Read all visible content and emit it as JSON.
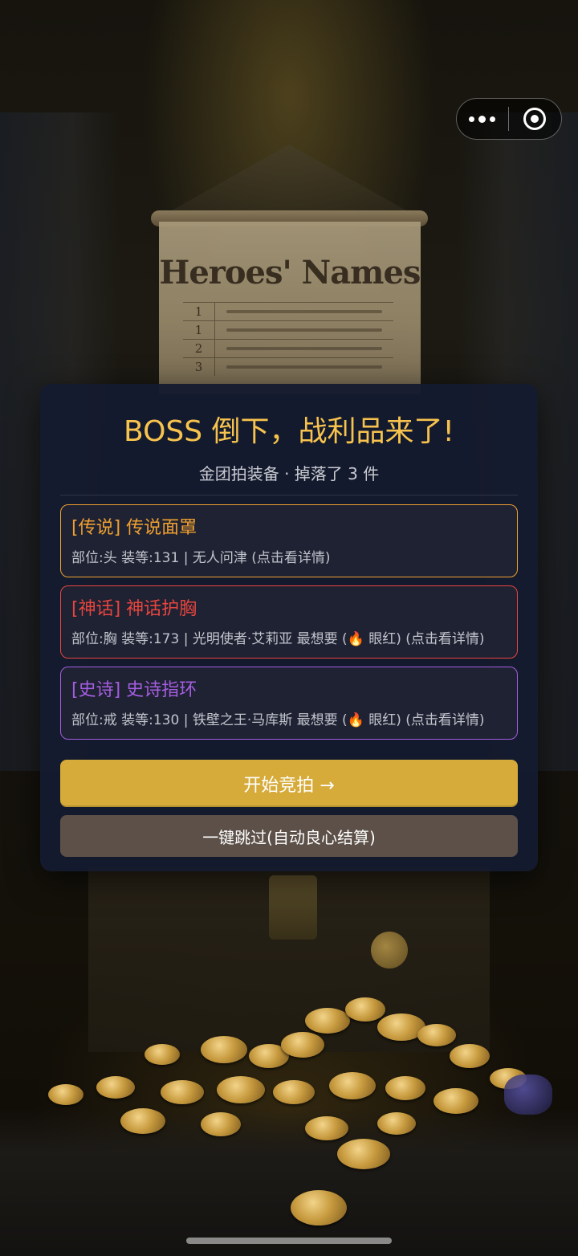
{
  "background": {
    "scroll_title": "Heroes' Names",
    "scroll_rows": [
      {
        "num": "1"
      },
      {
        "num": "1"
      },
      {
        "num": "2"
      },
      {
        "num": "3"
      }
    ]
  },
  "capsule": {
    "more_icon": "more-dots-icon",
    "close_icon": "target-circle-icon"
  },
  "modal": {
    "title": "BOSS 倒下，战利品来了!",
    "subtitle": "金团拍装备 · 掉落了 3 件",
    "items": [
      {
        "name": "[传说] 传说面罩",
        "meta_prefix": "部位:头 装等:131 | 无人问津 (点击看详情)",
        "fire": "",
        "meta_suffix": "",
        "color": "#f0a030"
      },
      {
        "name": "[神话] 神话护胸",
        "meta_prefix": "部位:胸 装等:173 | 光明使者·艾莉亚 最想要 (",
        "fire": "🔥",
        "meta_suffix": " 眼红) (点击看详情)",
        "color": "#e8453e"
      },
      {
        "name": "[史诗] 史诗指环",
        "meta_prefix": "部位:戒 装等:130 | 铁壁之王·马库斯 最想要 (",
        "fire": "🔥",
        "meta_suffix": " 眼红) (点击看详情)",
        "color": "#a65de0"
      }
    ],
    "start_label": "开始竞拍 →",
    "skip_label": "一键跳过(自动良心结算)"
  }
}
